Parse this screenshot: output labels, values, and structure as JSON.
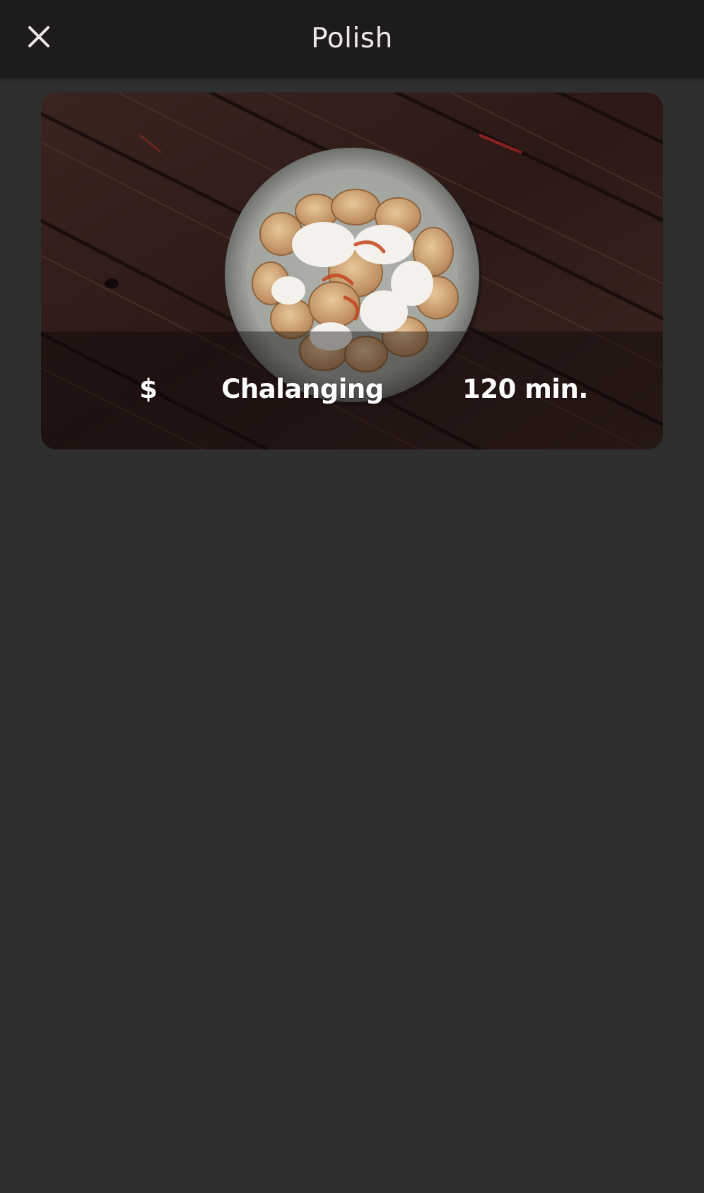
{
  "header": {
    "title": "Polish",
    "close_icon": "close-icon"
  },
  "recipe": {
    "price": "$",
    "difficulty": "Chalanging",
    "time": "120 min.",
    "image_icon": "dumplings-photo"
  },
  "colors": {
    "background": "#2f2f2f",
    "app_bar": "#1e1b1c",
    "title_text": "#ece6e8",
    "card_text": "#ffffff"
  }
}
